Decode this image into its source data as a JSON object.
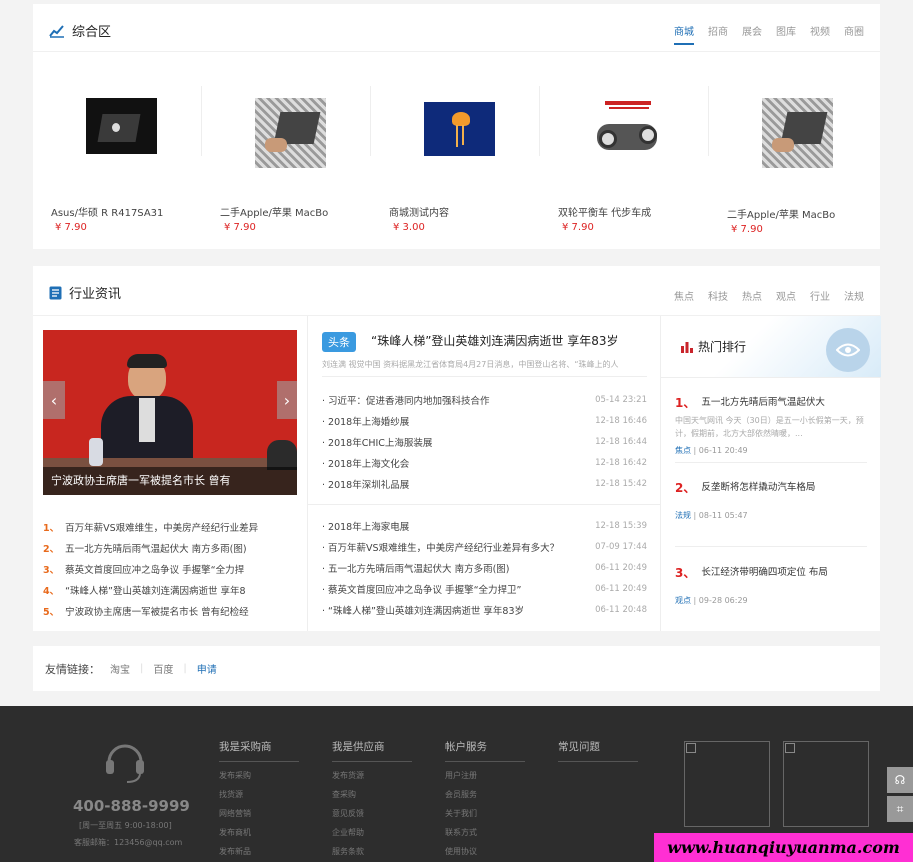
{
  "composite": {
    "title": "综合区",
    "tabs": [
      "商城",
      "招商",
      "展会",
      "图库",
      "视频",
      "商圈"
    ],
    "products": [
      {
        "name": "Asus/华硕 R R417SA31",
        "price": "¥ 7.90",
        "icon": "laptop-image"
      },
      {
        "name": "二手Apple/苹果 MacBo",
        "price": "¥ 7.90",
        "icon": "laptop-image"
      },
      {
        "name": "商城测试内容",
        "price": "¥ 3.00",
        "icon": "jellyfish-image"
      },
      {
        "name": "双轮平衡车 代步车成",
        "price": "¥ 7.90",
        "icon": "scooter-image"
      },
      {
        "name": "二手Apple/苹果 MacBo",
        "price": "¥ 7.90",
        "icon": "laptop-image"
      }
    ]
  },
  "news": {
    "title": "行业资讯",
    "tabs": [
      "焦点",
      "科技",
      "热点",
      "观点",
      "行业",
      "法规"
    ],
    "slide_caption": "宁波政协主席唐一军被提名市长 曾有",
    "headline_tag": "头条",
    "headline": "“珠峰人梯”登山英雄刘连满因病逝世 享年83岁",
    "summary": "刘连满 视觉中国 资料据黑龙江省体育局4月27日消息，中国登山名将、“珠峰上的人",
    "list1": [
      {
        "title": "习近平：促进香港同内地加强科技合作",
        "date": "05-14 23:21"
      },
      {
        "title": "2018年上海婚纱展",
        "date": "12-18 16:46"
      },
      {
        "title": "2018年CHIC上海服装展",
        "date": "12-18 16:44"
      },
      {
        "title": "2018年上海文化会",
        "date": "12-18 16:42"
      },
      {
        "title": "2018年深圳礼品展",
        "date": "12-18 15:42"
      }
    ],
    "list2": [
      {
        "title": "2018年上海家电展",
        "date": "12-18 15:39"
      },
      {
        "title": "百万年薪VS艰难维生，中美房产经纪行业差异有多大？",
        "date": "07-09 17:44"
      },
      {
        "title": "五一北方先晴后雨气温起伏大 南方多雨(图)",
        "date": "06-11 20:49"
      },
      {
        "title": "蔡英文首度回应冲之岛争议 手握擎“全力捍卫”",
        "date": "06-11 20:49"
      },
      {
        "title": "“珠峰人梯”登山英雄刘连满因病逝世 享年83岁",
        "date": "06-11 20:48"
      }
    ],
    "rank_list": [
      {
        "n": "1、",
        "title": "百万年薪VS艰难维生，中美房产经纪行业差异"
      },
      {
        "n": "2、",
        "title": "五一北方先晴后雨气温起伏大 南方多雨(图)"
      },
      {
        "n": "3、",
        "title": "蔡英文首度回应冲之岛争议 手握擎“全力捍"
      },
      {
        "n": "4、",
        "title": "“珠峰人梯”登山英雄刘连满因病逝世 享年8"
      },
      {
        "n": "5、",
        "title": "宁波政协主席唐一军被提名市长 曾有纪检经"
      }
    ],
    "hot_title": "热门排行",
    "hot": [
      {
        "n": "1、",
        "title": "五一北方先晴后雨气温起伏大",
        "desc": "中国天气网讯 今天（30日）是五一小长假第一天，预计，假期前，北方大部依然晴暖，...",
        "cat": "焦点",
        "date": "06-11 20:49"
      },
      {
        "n": "2、",
        "title": "反垄断将怎样撬动汽车格局",
        "desc": "",
        "cat": "法规",
        "date": "08-11 05:47"
      },
      {
        "n": "3、",
        "title": "长江经济带明确四项定位 布局",
        "desc": "",
        "cat": "观点",
        "date": "09-28 06:29"
      }
    ]
  },
  "links": {
    "label": "友情链接：",
    "items": [
      "淘宝",
      "百度",
      "申请"
    ]
  },
  "footer": {
    "phone": "400-888-9999",
    "hours": "[周一至周五 9:00-18:00]",
    "email": "客服邮箱：123456@qq.com",
    "cols": [
      {
        "title": "我是采购商",
        "links": [
          "发布采购",
          "找货源",
          "网络营销",
          "发布商机",
          "发布新品"
        ]
      },
      {
        "title": "我是供应商",
        "links": [
          "发布货源",
          "查采购",
          "意见反馈",
          "企业帮助",
          "服务条款"
        ]
      },
      {
        "title": "帐户服务",
        "links": [
          "用户注册",
          "会员服务",
          "关于我们",
          "联系方式",
          "使用协议"
        ]
      },
      {
        "title": "常见问题",
        "links": []
      }
    ]
  },
  "watermark": "www.huanqiuyuanma.com"
}
